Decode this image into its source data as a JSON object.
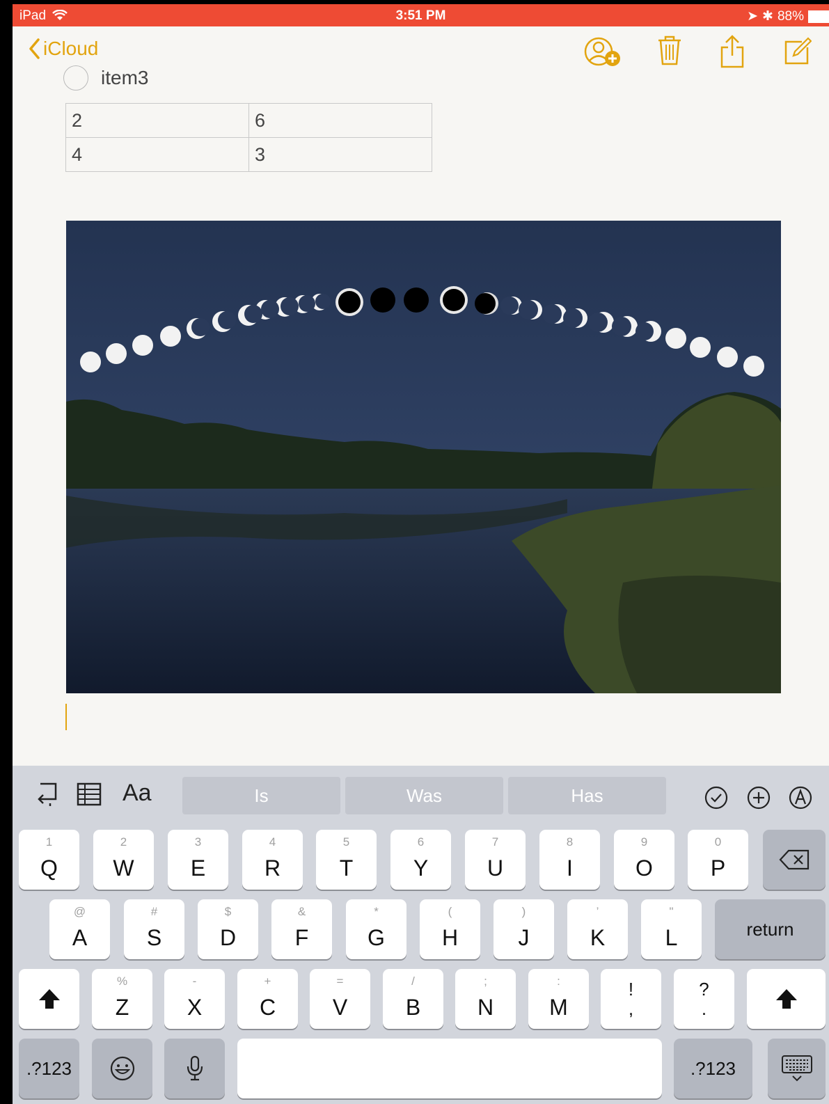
{
  "status": {
    "device": "iPad",
    "time": "3:51 PM",
    "battery": "88%"
  },
  "nav": {
    "back_label": "iCloud"
  },
  "note": {
    "checklist_item": "item3",
    "table": [
      [
        "2",
        "6"
      ],
      [
        "4",
        "3"
      ]
    ]
  },
  "colors": {
    "accent": "#e2a40f",
    "statusbar": "#ee4b34"
  },
  "keyboard": {
    "suggestions": [
      "Is",
      "Was",
      "Has"
    ],
    "format_label": "Aa",
    "row1": [
      {
        "alt": "1",
        "main": "Q"
      },
      {
        "alt": "2",
        "main": "W"
      },
      {
        "alt": "3",
        "main": "E"
      },
      {
        "alt": "4",
        "main": "R"
      },
      {
        "alt": "5",
        "main": "T"
      },
      {
        "alt": "6",
        "main": "Y"
      },
      {
        "alt": "7",
        "main": "U"
      },
      {
        "alt": "8",
        "main": "I"
      },
      {
        "alt": "9",
        "main": "O"
      },
      {
        "alt": "0",
        "main": "P"
      }
    ],
    "row2": [
      {
        "alt": "@",
        "main": "A"
      },
      {
        "alt": "#",
        "main": "S"
      },
      {
        "alt": "$",
        "main": "D"
      },
      {
        "alt": "&",
        "main": "F"
      },
      {
        "alt": "*",
        "main": "G"
      },
      {
        "alt": "(",
        "main": "H"
      },
      {
        "alt": ")",
        "main": "J"
      },
      {
        "alt": "’",
        "main": "K"
      },
      {
        "alt": "\"",
        "main": "L"
      }
    ],
    "row3": [
      {
        "alt": "%",
        "main": "Z"
      },
      {
        "alt": "-",
        "main": "X"
      },
      {
        "alt": "+",
        "main": "C"
      },
      {
        "alt": "=",
        "main": "V"
      },
      {
        "alt": "/",
        "main": "B"
      },
      {
        "alt": ";",
        "main": "N"
      },
      {
        "alt": ":",
        "main": "M"
      }
    ],
    "exclaim_top": "!",
    "exclaim_bottom": ",",
    "question_top": "?",
    "question_bottom": ".",
    "return_label": "return",
    "numbers_label": ".?123"
  }
}
